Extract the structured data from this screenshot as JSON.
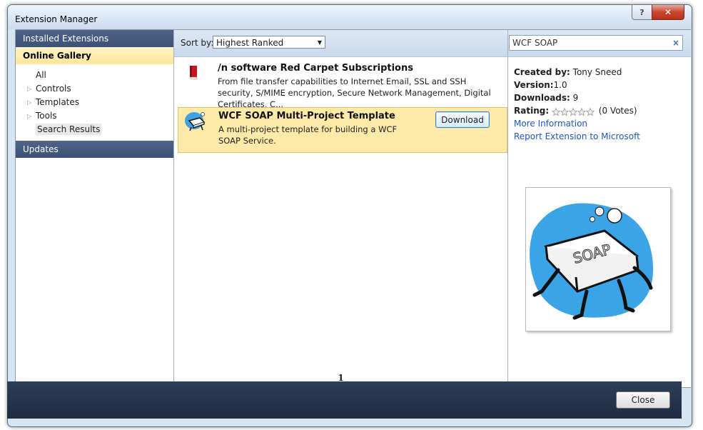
{
  "window": {
    "title": "Extension Manager",
    "help_label": "?",
    "close_label": "✕"
  },
  "nav": {
    "installed": "Installed Extensions",
    "online": "Online Gallery",
    "items": [
      {
        "label": "All",
        "expandable": false,
        "selected": false
      },
      {
        "label": "Controls",
        "expandable": true,
        "selected": false
      },
      {
        "label": "Templates",
        "expandable": true,
        "selected": false
      },
      {
        "label": "Tools",
        "expandable": true,
        "selected": false
      },
      {
        "label": "Search Results",
        "expandable": false,
        "selected": true
      }
    ],
    "updates": "Updates"
  },
  "toolbar": {
    "sort_label": "Sort by:",
    "sort_value": "Highest Ranked"
  },
  "search": {
    "value": "WCF SOAP",
    "clear": "×"
  },
  "results": [
    {
      "title": "/n software Red Carpet Subscriptions",
      "description": "From file transfer capabilities to Internet Email, SSL and SSH security, S/MIME encryption, Secure Network Management, Digital Certificates, C..."
    },
    {
      "title": "WCF SOAP Multi-Project Template",
      "description": "A multi-project template for building a WCF SOAP Service.",
      "button": "Download"
    }
  ],
  "pager": {
    "page": "1"
  },
  "details": {
    "created_label": "Created by:",
    "created_value": "Tony Sneed",
    "version_label": "Version:",
    "version_value": "1.0",
    "downloads_label": "Downloads:",
    "downloads_value": "9",
    "rating_label": "Rating:",
    "rating_votes": "(0 Votes)",
    "rating_value": 0,
    "more_info": "More Information",
    "report": "Report Extension to Microsoft"
  },
  "footer": {
    "close": "Close"
  },
  "colors": {
    "accent": "#3d5176",
    "selection": "#fde9a8",
    "link": "#1a57c2",
    "footer": "#1f2c42"
  }
}
